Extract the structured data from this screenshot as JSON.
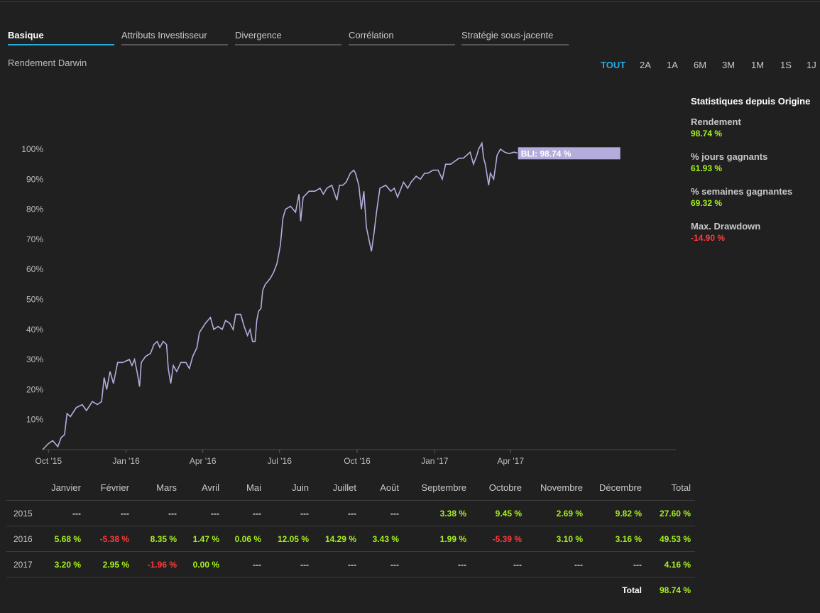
{
  "tabs": [
    {
      "label": "Basique",
      "active": true
    },
    {
      "label": "Attributs Investisseur",
      "active": false
    },
    {
      "label": "Divergence",
      "active": false
    },
    {
      "label": "Corrélation",
      "active": false
    },
    {
      "label": "Stratégie sous-jacente",
      "active": false
    }
  ],
  "chart_title": "Rendement Darwin",
  "ranges": [
    {
      "label": "TOUT",
      "active": true
    },
    {
      "label": "2A",
      "active": false
    },
    {
      "label": "1A",
      "active": false
    },
    {
      "label": "6M",
      "active": false
    },
    {
      "label": "3M",
      "active": false
    },
    {
      "label": "1M",
      "active": false
    },
    {
      "label": "1S",
      "active": false
    },
    {
      "label": "1J",
      "active": false
    }
  ],
  "stats": {
    "title": "Statistiques depuis Origine",
    "items": [
      {
        "label": "Rendement",
        "value": "98.74 %",
        "sign": "pos"
      },
      {
        "label": "% jours gagnants",
        "value": "61.93 %",
        "sign": "pos"
      },
      {
        "label": "% semaines gagnantes",
        "value": "69.32 %",
        "sign": "pos"
      },
      {
        "label": "Max. Drawdown",
        "value": "-14.90 %",
        "sign": "neg"
      }
    ]
  },
  "colors": {
    "line": "#b3acdc",
    "accent": "#29a8e0",
    "positive": "#a6f21e",
    "negative": "#ff3b3b",
    "background": "#202020"
  },
  "chart_data": {
    "type": "line",
    "series": [
      {
        "name": "BLI",
        "label": "BLI: 98.74 %",
        "points": [
          [
            "2015-09-24",
            0
          ],
          [
            "2015-10-01",
            2
          ],
          [
            "2015-10-06",
            3
          ],
          [
            "2015-10-12",
            1
          ],
          [
            "2015-10-16",
            4
          ],
          [
            "2015-10-20",
            5
          ],
          [
            "2015-10-23",
            12
          ],
          [
            "2015-10-27",
            11
          ],
          [
            "2015-11-03",
            14
          ],
          [
            "2015-11-10",
            15
          ],
          [
            "2015-11-15",
            13
          ],
          [
            "2015-11-22",
            16
          ],
          [
            "2015-11-28",
            15
          ],
          [
            "2015-12-03",
            16
          ],
          [
            "2015-12-06",
            24
          ],
          [
            "2015-12-09",
            20
          ],
          [
            "2015-12-13",
            26
          ],
          [
            "2015-12-17",
            22
          ],
          [
            "2015-12-22",
            29
          ],
          [
            "2015-12-28",
            29
          ],
          [
            "2016-01-05",
            30
          ],
          [
            "2016-01-08",
            28
          ],
          [
            "2016-01-11",
            30
          ],
          [
            "2016-01-14",
            26
          ],
          [
            "2016-01-17",
            21
          ],
          [
            "2016-01-19",
            29
          ],
          [
            "2016-01-24",
            31
          ],
          [
            "2016-01-30",
            32
          ],
          [
            "2016-02-03",
            35
          ],
          [
            "2016-02-07",
            36
          ],
          [
            "2016-02-10",
            34
          ],
          [
            "2016-02-14",
            36
          ],
          [
            "2016-02-18",
            35
          ],
          [
            "2016-02-20",
            27
          ],
          [
            "2016-02-23",
            22
          ],
          [
            "2016-02-26",
            28
          ],
          [
            "2016-03-01",
            26
          ],
          [
            "2016-03-06",
            29
          ],
          [
            "2016-03-12",
            29
          ],
          [
            "2016-03-16",
            27
          ],
          [
            "2016-03-20",
            31
          ],
          [
            "2016-03-25",
            34
          ],
          [
            "2016-03-28",
            39
          ],
          [
            "2016-04-04",
            42
          ],
          [
            "2016-04-10",
            44
          ],
          [
            "2016-04-14",
            40
          ],
          [
            "2016-04-19",
            41
          ],
          [
            "2016-04-24",
            40
          ],
          [
            "2016-04-28",
            43
          ],
          [
            "2016-05-03",
            42
          ],
          [
            "2016-05-07",
            40
          ],
          [
            "2016-05-10",
            45
          ],
          [
            "2016-05-16",
            45
          ],
          [
            "2016-05-20",
            41
          ],
          [
            "2016-05-24",
            38
          ],
          [
            "2016-05-27",
            40
          ],
          [
            "2016-05-30",
            36
          ],
          [
            "2016-06-02",
            36
          ],
          [
            "2016-06-04",
            43
          ],
          [
            "2016-06-06",
            46
          ],
          [
            "2016-06-09",
            47
          ],
          [
            "2016-06-11",
            53
          ],
          [
            "2016-06-14",
            55
          ],
          [
            "2016-06-20",
            57
          ],
          [
            "2016-06-24",
            59
          ],
          [
            "2016-06-28",
            62
          ],
          [
            "2016-07-02",
            68
          ],
          [
            "2016-07-05",
            77
          ],
          [
            "2016-07-08",
            80
          ],
          [
            "2016-07-14",
            81
          ],
          [
            "2016-07-20",
            79
          ],
          [
            "2016-07-24",
            85
          ],
          [
            "2016-07-26",
            76
          ],
          [
            "2016-07-29",
            84
          ],
          [
            "2016-08-05",
            86
          ],
          [
            "2016-08-12",
            86
          ],
          [
            "2016-08-18",
            87
          ],
          [
            "2016-08-22",
            85
          ],
          [
            "2016-08-26",
            87
          ],
          [
            "2016-09-01",
            88
          ],
          [
            "2016-09-07",
            83
          ],
          [
            "2016-09-10",
            88
          ],
          [
            "2016-09-14",
            88
          ],
          [
            "2016-09-18",
            89
          ],
          [
            "2016-09-23",
            92
          ],
          [
            "2016-09-27",
            93
          ],
          [
            "2016-09-29",
            92
          ],
          [
            "2016-10-03",
            88
          ],
          [
            "2016-10-06",
            80
          ],
          [
            "2016-10-09",
            86
          ],
          [
            "2016-10-12",
            74
          ],
          [
            "2016-10-18",
            66
          ],
          [
            "2016-10-21",
            72
          ],
          [
            "2016-10-24",
            79
          ],
          [
            "2016-10-28",
            87
          ],
          [
            "2016-11-04",
            88
          ],
          [
            "2016-11-10",
            86
          ],
          [
            "2016-11-14",
            87
          ],
          [
            "2016-11-18",
            84
          ],
          [
            "2016-11-25",
            89
          ],
          [
            "2016-11-30",
            87
          ],
          [
            "2016-12-04",
            89
          ],
          [
            "2016-12-10",
            91
          ],
          [
            "2016-12-15",
            90
          ],
          [
            "2016-12-20",
            92
          ],
          [
            "2016-12-24",
            92
          ],
          [
            "2016-12-30",
            93
          ],
          [
            "2017-01-05",
            93
          ],
          [
            "2017-01-10",
            90
          ],
          [
            "2017-01-14",
            95
          ],
          [
            "2017-01-20",
            95
          ],
          [
            "2017-01-25",
            96
          ],
          [
            "2017-01-30",
            97
          ],
          [
            "2017-02-04",
            97
          ],
          [
            "2017-02-08",
            98
          ],
          [
            "2017-02-12",
            99
          ],
          [
            "2017-02-16",
            95
          ],
          [
            "2017-02-20",
            98
          ],
          [
            "2017-02-22",
            100
          ],
          [
            "2017-02-26",
            102
          ],
          [
            "2017-02-28",
            97
          ],
          [
            "2017-03-02",
            95
          ],
          [
            "2017-03-06",
            88
          ],
          [
            "2017-03-08",
            92
          ],
          [
            "2017-03-12",
            90
          ],
          [
            "2017-03-16",
            98
          ],
          [
            "2017-03-20",
            100
          ],
          [
            "2017-03-25",
            99
          ],
          [
            "2017-03-30",
            98.5
          ],
          [
            "2017-04-05",
            99
          ],
          [
            "2017-04-09",
            98.74
          ]
        ]
      }
    ],
    "x_ticks": [
      {
        "date": "2015-10-01",
        "label": "Oct '15"
      },
      {
        "date": "2016-01-01",
        "label": "Jan '16"
      },
      {
        "date": "2016-04-01",
        "label": "Apr '16"
      },
      {
        "date": "2016-07-01",
        "label": "Jul '16"
      },
      {
        "date": "2016-10-01",
        "label": "Oct '16"
      },
      {
        "date": "2017-01-01",
        "label": "Jan '17"
      },
      {
        "date": "2017-04-01",
        "label": "Apr '17"
      }
    ],
    "y_ticks": [
      {
        "value": 10,
        "label": "10%"
      },
      {
        "value": 20,
        "label": "20%"
      },
      {
        "value": 30,
        "label": "30%"
      },
      {
        "value": 40,
        "label": "40%"
      },
      {
        "value": 50,
        "label": "50%"
      },
      {
        "value": 60,
        "label": "60%"
      },
      {
        "value": 70,
        "label": "70%"
      },
      {
        "value": 80,
        "label": "80%"
      },
      {
        "value": 90,
        "label": "90%"
      },
      {
        "value": 100,
        "label": "100%"
      }
    ],
    "x_range": [
      "2015-09-24",
      "2017-10-14"
    ],
    "y_range": [
      0,
      100
    ],
    "grid": false
  },
  "table": {
    "headers": [
      "",
      "Janvier",
      "Février",
      "Mars",
      "Avril",
      "Mai",
      "Juin",
      "Juillet",
      "Août",
      "Septembre",
      "Octobre",
      "Novembre",
      "Décembre",
      "Total"
    ],
    "rows": [
      {
        "year": "2015",
        "cells": [
          "---",
          "---",
          "---",
          "---",
          "---",
          "---",
          "---",
          "---",
          "3.38 %",
          "9.45 %",
          "2.69 %",
          "9.82 %",
          "27.60 %"
        ]
      },
      {
        "year": "2016",
        "cells": [
          "5.68 %",
          "-5.38 %",
          "8.35 %",
          "1.47 %",
          "0.06 %",
          "12.05 %",
          "14.29 %",
          "3.43 %",
          "1.99 %",
          "-5.39 %",
          "3.10 %",
          "3.16 %",
          "49.53 %"
        ]
      },
      {
        "year": "2017",
        "cells": [
          "3.20 %",
          "2.95 %",
          "-1.96 %",
          "0.00 %",
          "---",
          "---",
          "---",
          "---",
          "---",
          "---",
          "---",
          "---",
          "4.16 %"
        ]
      }
    ],
    "total_label": "Total",
    "total_value": "98.74 %"
  }
}
